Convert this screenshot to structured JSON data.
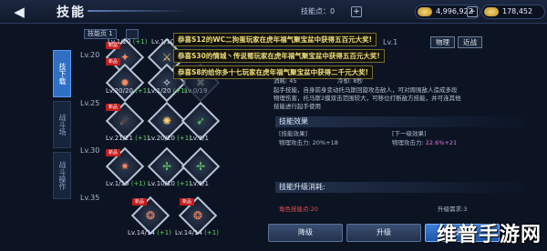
{
  "header": {
    "back_icon": "back-arrow-icon",
    "title": "技能",
    "skill_points_label": "技能点：0",
    "currency1": "4,996,922",
    "currency2": "178,452"
  },
  "side_tabs": [
    "技下载",
    "战斗场",
    "战斗操作"
  ],
  "filter": {
    "tab1": "技能页 1",
    "tab2": ""
  },
  "levels": [
    "Lv.20",
    "Lv.25",
    "Lv.30",
    "Lv.35"
  ],
  "skills": [
    {
      "count": "Lv.1/20",
      "plus": "(+1)",
      "new": "新品"
    },
    {
      "count": "Lv.1/10",
      "plus": "",
      "new": ""
    },
    {
      "count": "Lv.20/20",
      "plus": "(+1)",
      "new": "新品"
    },
    {
      "count": "Lv.1/20",
      "plus": "(+1)",
      "new": ""
    },
    {
      "count": "Lv.0/19",
      "plus": "",
      "new": ""
    },
    {
      "count": "Lv.21/21",
      "plus": "(+1)",
      "new": "新品"
    },
    {
      "count": "Lv.20/20",
      "plus": "(+1)",
      "new": ""
    },
    {
      "count": "Lv.1/1",
      "plus": "",
      "new": ""
    },
    {
      "count": "Lv.1/10",
      "plus": "(+1)",
      "new": "新品"
    },
    {
      "count": "Lv.10/10",
      "plus": "(+1)",
      "new": ""
    },
    {
      "count": "Lv.1/1",
      "plus": "",
      "new": ""
    },
    {
      "count": "Lv.14/14",
      "plus": "(+1)",
      "new": "新品"
    },
    {
      "count": "Lv.14/14",
      "plus": "(+1)",
      "new": "新品"
    }
  ],
  "notices": [
    "恭喜S12的WC二狗蛋玩家在虎年福气聚宝盆中获得五百元大奖!",
    "恭喜S30的情城丶传说蜀玩家在虎年福气聚宝盆中获得五百元大奖!",
    "恭喜S8的给你多十七玩家在虎年福气聚宝盆中获得二千元大奖!"
  ],
  "detail": {
    "level": "Lv.1",
    "tag1": "物理",
    "tag2": "近战",
    "cost": "消耗: 45",
    "cooldown": "冷却: 8秒",
    "desc_line1": "起手技能，自身前身变动托马斯回旋攻击敌人，可对周围敌人造成多段",
    "desc_line2": "物理伤害，托马斯2摸双击范围较大，可移位打断敌方技能，并可连其他",
    "desc_line3": "技能进行起手使用",
    "effect_title": "技能效果",
    "current_label": "[技能效果]",
    "current_value_label": "物理攻击力: 20%+18",
    "next_label": "[下一级效果]",
    "next_value_label": "物理攻击力:",
    "next_value": "22.6%+21",
    "upgrade_title": "技能升级消耗:",
    "req_label": "升级需求:3",
    "cost_red": "角色技能点:20"
  },
  "buttons": {
    "btn1": "降级",
    "btn2": "升级",
    "btn3": "确定"
  },
  "watermark": "维普手游网"
}
